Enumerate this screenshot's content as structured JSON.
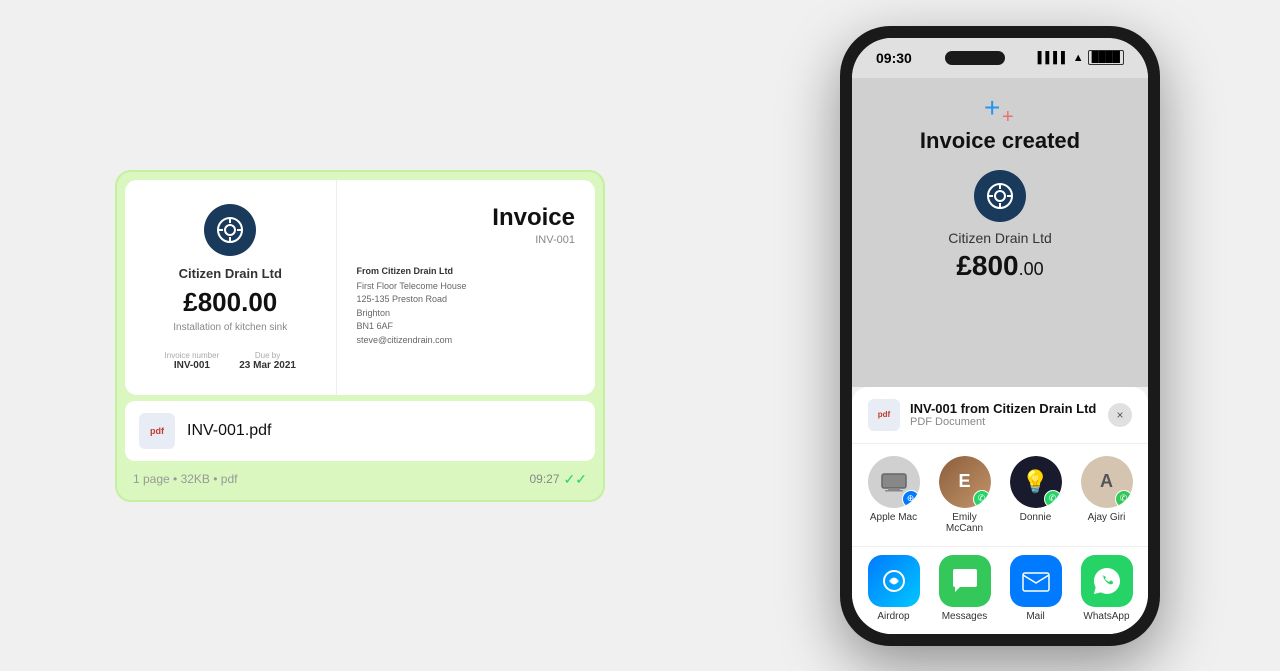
{
  "left": {
    "invoice": {
      "company_name": "Citizen Drain Ltd",
      "amount": "£800.00",
      "description": "Installation of kitchen sink",
      "invoice_number_label": "Invoice number",
      "invoice_number": "INV-001",
      "due_by_label": "Due by",
      "due_by": "23 Mar 2021",
      "title": "Invoice",
      "ref": "INV-001",
      "from_label": "From Citizen Drain Ltd",
      "address_line1": "First Floor Telecome House",
      "address_line2": "125-135 Preston Road",
      "address_line3": "Brighton",
      "address_line4": "BN1 6AF",
      "email": "steve@citizendrain.com"
    },
    "pdf": {
      "icon_label": "pdf",
      "filename": "INV-001.pdf",
      "meta": "1 page • 32KB • pdf",
      "time": "09:27"
    }
  },
  "right": {
    "status_bar": {
      "time": "09:30"
    },
    "app": {
      "title": "Invoice created",
      "company": "Citizen Drain Ltd",
      "amount_prefix": "£",
      "amount_whole": "800",
      "amount_decimal": ".00"
    },
    "share": {
      "pdf_label": "pdf",
      "title": "INV-001 from Citizen Drain Ltd",
      "subtitle": "PDF Document",
      "close": "×"
    },
    "contacts": [
      {
        "name": "Apple Mac",
        "initials": "🖥",
        "badge": "airdrop"
      },
      {
        "name": "Emily McCann",
        "initials": "E",
        "badge": "whatsapp"
      },
      {
        "name": "Donnie",
        "initials": "💡",
        "badge": "whatsapp"
      },
      {
        "name": "Ajay Giri",
        "initials": "A",
        "badge": "messages"
      }
    ],
    "apps": [
      {
        "name": "Airdrop",
        "icon_type": "airdrop"
      },
      {
        "name": "Messages",
        "icon_type": "messages"
      },
      {
        "name": "Mail",
        "icon_type": "mail"
      },
      {
        "name": "WhatsApp",
        "icon_type": "whatsapp"
      }
    ]
  }
}
